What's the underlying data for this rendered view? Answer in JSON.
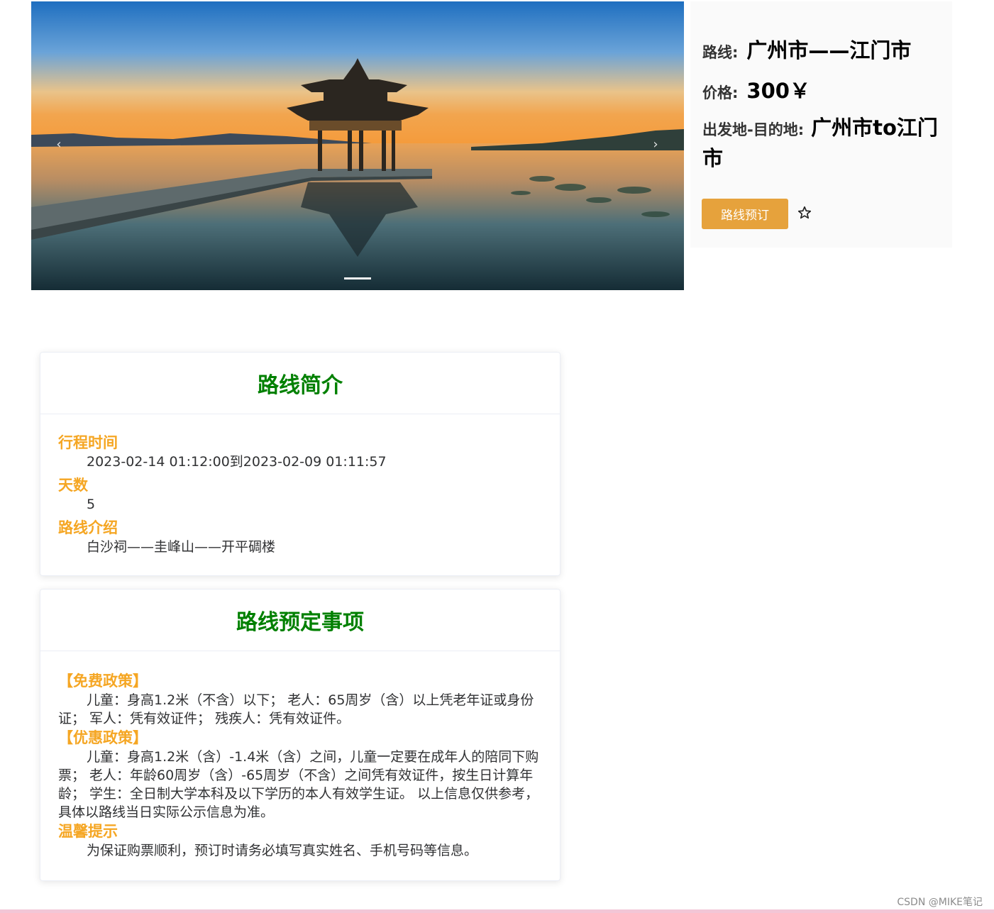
{
  "carousel": {
    "prev_icon": "chevron-left-icon",
    "next_icon": "chevron-right-icon",
    "prev_glyph": "‹",
    "next_glyph": "›",
    "active_index": 1,
    "slide_count": 1
  },
  "info": {
    "route_label": "路线:",
    "route_value": "广州市——江门市",
    "price_label": "价格:",
    "price_value": "300￥",
    "od_label": "出发地-目的地:",
    "od_value": "广州市to江门市",
    "book_label": "路线预订",
    "favorite_icon": "star-outline-icon"
  },
  "intro_card": {
    "title": "路线简介",
    "sections": [
      {
        "title": "行程时间",
        "text": "2023-02-14 01:12:00到2023-02-09 01:11:57"
      },
      {
        "title": "天数",
        "text": "5"
      },
      {
        "title": "路线介绍",
        "text": "白沙祠——圭峰山——开平碉楼"
      }
    ]
  },
  "notice_card": {
    "title": "路线预定事项",
    "sections": [
      {
        "title": "【免费政策】",
        "text": "儿童：身高1.2米（不含）以下； 老人：65周岁（含）以上凭老年证或身份证； 军人：凭有效证件； 残疾人：凭有效证件。"
      },
      {
        "title": "【优惠政策】",
        "text": "儿童：身高1.2米（含）-1.4米（含）之间，儿童一定要在成年人的陪同下购票； 老人：年龄60周岁（含）-65周岁（不含）之间凭有效证件，按生日计算年龄； 学生：全日制大学本科及以下学历的本人有效学生证。 以上信息仅供参考，具体以路线当日实际公示信息为准。"
      },
      {
        "title": "温馨提示",
        "text": "为保证购票顺利，预订时请务必填写真实姓名、手机号码等信息。"
      }
    ]
  },
  "watermark": "CSDN @MIKE笔记",
  "colors": {
    "accent_orange": "#e6a23c",
    "section_title": "#f5a623",
    "card_title_green": "#008000"
  }
}
